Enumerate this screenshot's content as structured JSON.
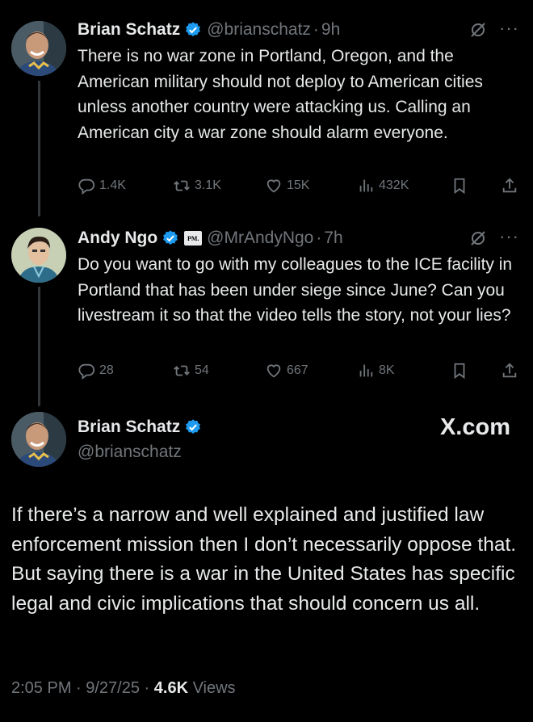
{
  "tweets": [
    {
      "name": "Brian Schatz",
      "handle": "@brianschatz",
      "separator": "·",
      "time": "9h",
      "text": "There is no war zone in Portland, Oregon, and the American military should not deploy to American cities unless another country were attacking us. Calling an American city a war zone should alarm everyone.",
      "replies": "1.4K",
      "reposts": "3.1K",
      "likes": "15K",
      "views": "432K"
    },
    {
      "name": "Andy Ngo",
      "badge": "PM.",
      "handle": "@MrAndyNgo",
      "separator": "·",
      "time": "7h",
      "text": "Do you want to go with my colleagues to the ICE facility in Portland that has been under siege since June? Can you livestream it so that the video tells the story, not your lies?",
      "replies": "28",
      "reposts": "54",
      "likes": "667",
      "views": "8K"
    }
  ],
  "main": {
    "name": "Brian Schatz",
    "handle": "@brianschatz",
    "watermark": "X.com",
    "text": "If there’s a narrow and well explained and justified law enforcement mission then I don’t necessarily oppose that. But saying there is a war in the United States has specific legal and civic implications that should concern us all.",
    "time": "2:05 PM · 9/27/25 · ",
    "views_count": "4.6K",
    "views_label": " Views"
  },
  "icons": [
    "verified-icon",
    "grok-icon",
    "more-icon",
    "reply-icon",
    "repost-icon",
    "like-icon",
    "views-icon",
    "bookmark-icon",
    "share-icon"
  ],
  "colors": {
    "background": "#000000",
    "text": "#e7e9ea",
    "secondary": "#71767b",
    "verified": "#1d9bf0"
  }
}
